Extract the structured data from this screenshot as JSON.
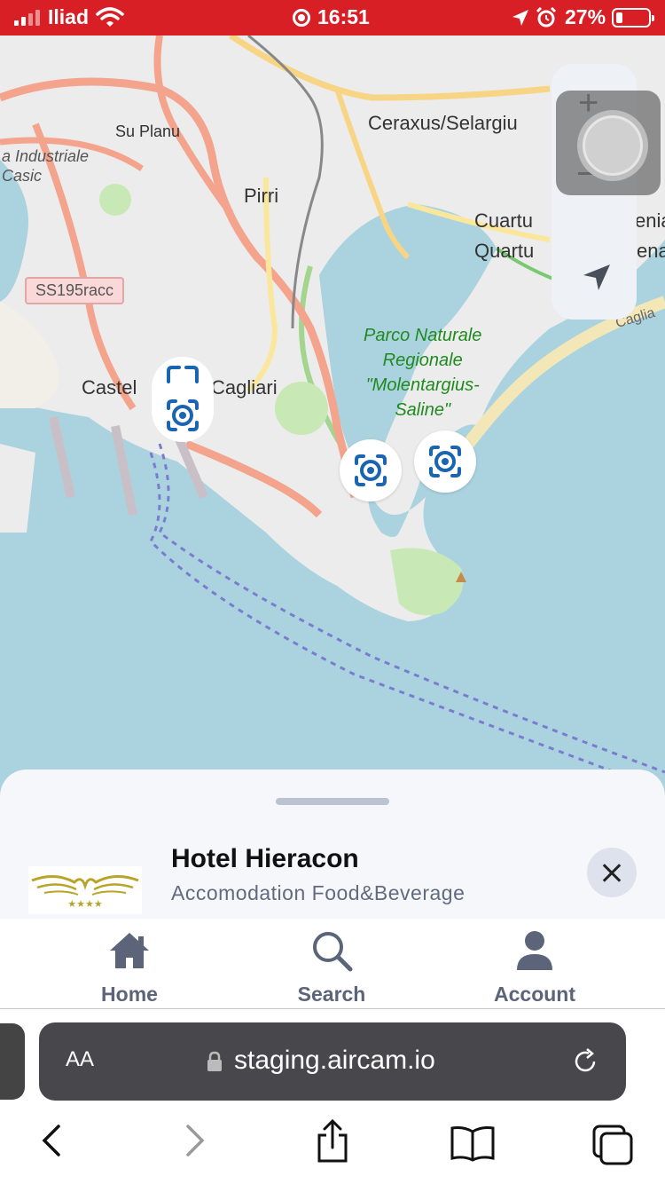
{
  "status_bar": {
    "carrier": "Iliad",
    "time": "16:51",
    "battery": "27%"
  },
  "map": {
    "labels": {
      "su_planu": "Su Planu",
      "zona_industriale": "a Industriale\nCasic",
      "pirri": "Pirri",
      "ceraxus": "Ceraxus/Selargiu",
      "quartu_1": "Cuartu",
      "quartu_1b": "enia",
      "quartu_2": "Quartu",
      "quartu_2b": "ena",
      "road_ss195": "SS195racc",
      "cagliari_a": "Castel",
      "cagliari_b": "Cagliari",
      "cagliari_coast": "Caglia",
      "park": "Parco Naturale\nRegionale\n\"Molentargius-\nSaline\""
    }
  },
  "zoom_controls": {
    "plus": "+"
  },
  "sheet": {
    "title": "Hotel Hieracon",
    "categories": "Accomodation Food&Beverage",
    "logo_stars": "★★★★"
  },
  "tabs": [
    {
      "label": "Home",
      "icon": "home-icon"
    },
    {
      "label": "Search",
      "icon": "search-icon"
    },
    {
      "label": "Account",
      "icon": "account-icon"
    }
  ],
  "browser": {
    "text_size_label": "AA",
    "url": "staging.aircam.io"
  },
  "colors": {
    "status_bar": "#d81f26",
    "water": "#aad3df",
    "marker_blue": "#1b64b0",
    "tab_gray": "#5b6478"
  }
}
